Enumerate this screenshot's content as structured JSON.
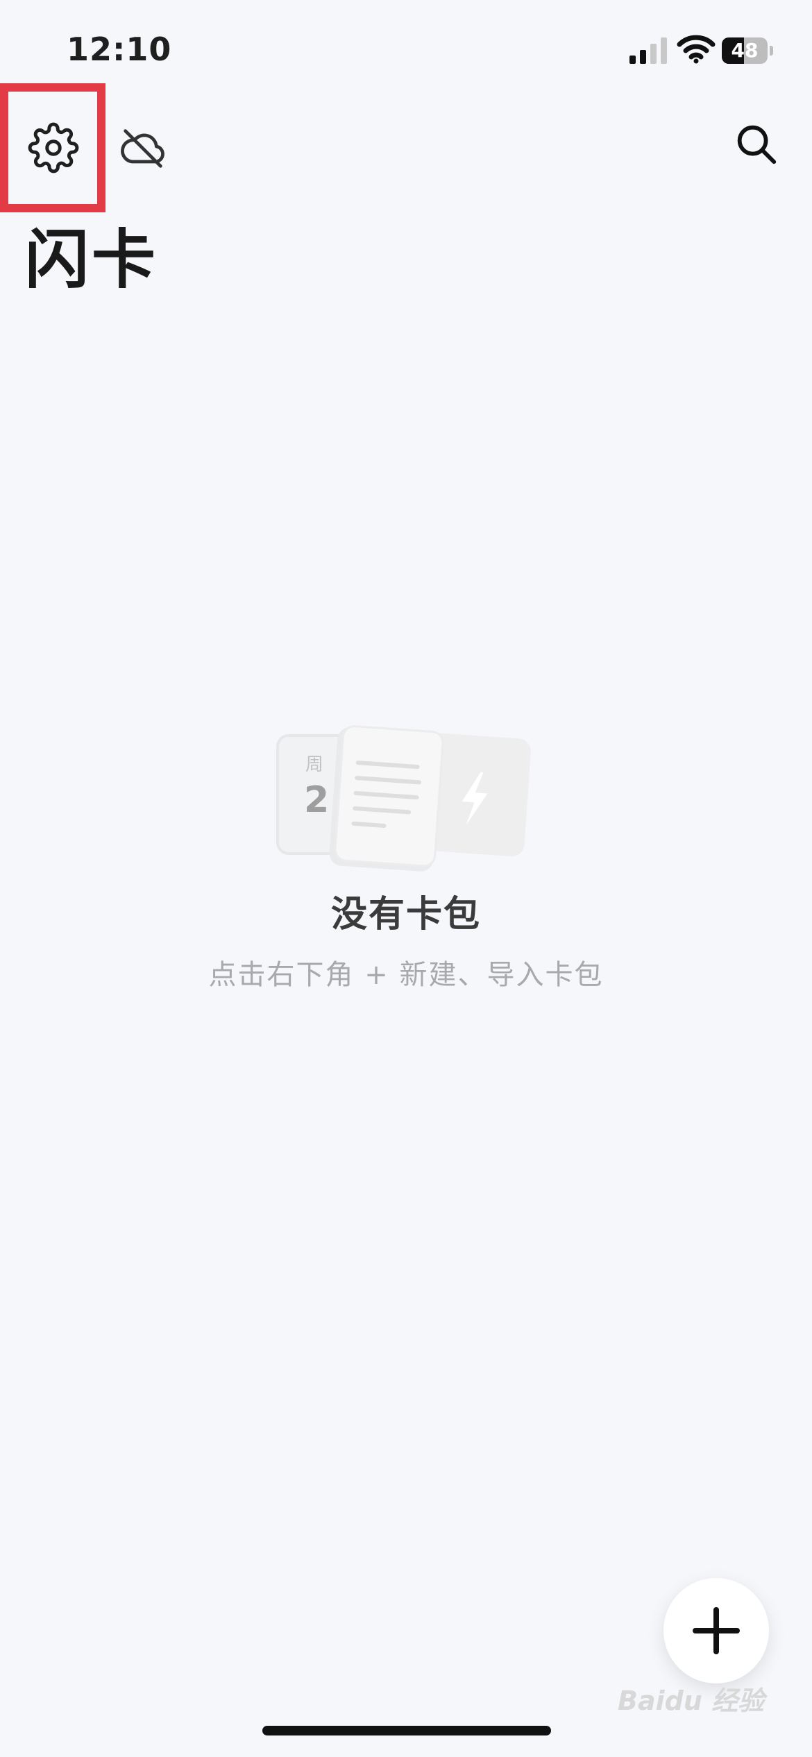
{
  "status_bar": {
    "time": "12:10",
    "battery_percent": "48",
    "battery_level": 0.48
  },
  "toolbar": {
    "settings_icon": "gear-icon",
    "sync_icon": "cloud-off-icon",
    "search_icon": "search-icon",
    "highlight_color": "#e23b46"
  },
  "page": {
    "title": "闪卡"
  },
  "empty_state": {
    "title": "没有卡包",
    "hint": "点击右下角 + 新建、导入卡包",
    "illustration_day_label": "周",
    "illustration_date_digit": "2"
  },
  "fab": {
    "icon": "plus-icon"
  },
  "watermark": {
    "text": "Baidu 经验"
  },
  "colors": {
    "background": "#f5f7fa",
    "text_primary": "#1a1a1a",
    "text_secondary": "#a9a9ad",
    "accent": "#e23b46"
  }
}
